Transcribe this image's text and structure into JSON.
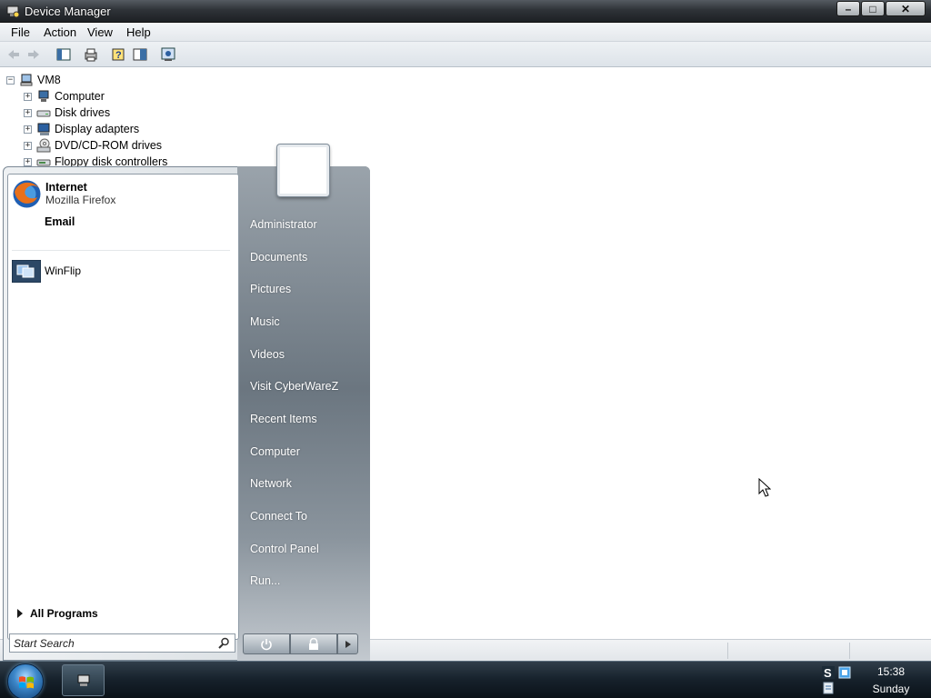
{
  "window": {
    "title": "Device Manager",
    "buttons": {
      "minimize": "–",
      "maximize": "□",
      "close": "✕"
    }
  },
  "menu": [
    "File",
    "Action",
    "View",
    "Help"
  ],
  "toolbar": {
    "icons": [
      "back-arrow-icon",
      "forward-arrow-icon",
      "show-hide-console-tree-icon",
      "print-icon",
      "help-icon",
      "properties-icon",
      "scan-hardware-icon"
    ]
  },
  "tree": {
    "root": "VM8",
    "nodes": [
      "Computer",
      "Disk drives",
      "Display adapters",
      "DVD/CD-ROM drives",
      "Floppy disk controllers"
    ]
  },
  "start_menu": {
    "pinned": {
      "internet_title": "Internet",
      "internet_subtitle": "Mozilla Firefox",
      "email_title": "Email"
    },
    "recent": [
      "WinFlip"
    ],
    "all_programs": "All Programs",
    "search_placeholder": "Start Search",
    "right_items": [
      "Administrator",
      "Documents",
      "Pictures",
      "Music",
      "Videos",
      "Visit CyberWareZ",
      "Recent Items",
      "Computer",
      "Network",
      "Connect To",
      "Control Panel",
      "Run..."
    ]
  },
  "taskbar": {
    "clock_time": "15:38",
    "clock_day": "Sunday"
  },
  "colors": {
    "taskbar": "#16212b",
    "titlebar": "#2f3338",
    "start_right_panel": "#6b7680"
  }
}
